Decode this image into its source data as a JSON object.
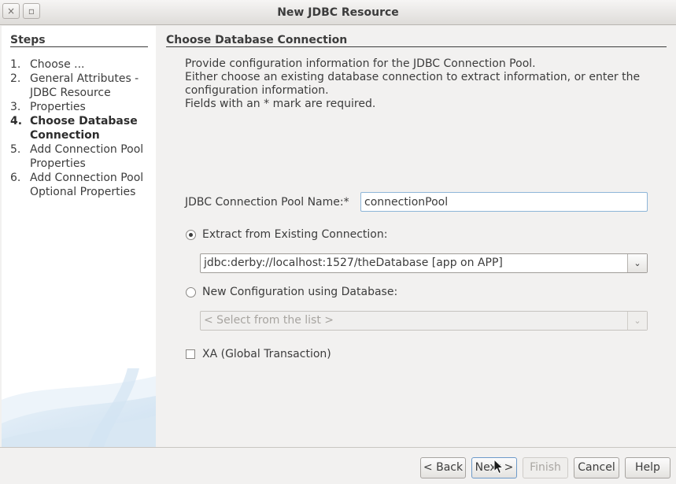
{
  "window": {
    "title": "New JDBC Resource",
    "close_glyph": "×",
    "maximize_glyph": "▫"
  },
  "sidebar": {
    "title": "Steps",
    "steps": [
      {
        "num": "1.",
        "label": "Choose ...",
        "current": false
      },
      {
        "num": "2.",
        "label": "General Attributes - JDBC Resource",
        "current": false
      },
      {
        "num": "3.",
        "label": "Properties",
        "current": false
      },
      {
        "num": "4.",
        "label": "Choose Database Connection",
        "current": true
      },
      {
        "num": "5.",
        "label": "Add Connection Pool Properties",
        "current": false
      },
      {
        "num": "6.",
        "label": "Add Connection Pool Optional Properties",
        "current": false
      }
    ]
  },
  "main": {
    "title": "Choose Database Connection",
    "description": [
      "Provide configuration information for the JDBC Connection Pool.",
      "Either choose an existing database connection to extract information, or enter the configuration information.",
      "Fields with an * mark are required."
    ],
    "pool_name_label": "JDBC Connection Pool Name:*",
    "pool_name_value": "connectionPool",
    "extract_label": "Extract from Existing Connection:",
    "extract_checked": true,
    "existing_connection_value": "jdbc:derby://localhost:1527/theDatabase [app on APP]",
    "new_config_label": "New Configuration using Database:",
    "new_config_checked": false,
    "database_placeholder": "< Select from the list >",
    "xa_label": "XA (Global Transaction)",
    "xa_checked": false,
    "dropdown_glyph": "⌄"
  },
  "footer": {
    "back_label": "< Back",
    "next_label": "Next >",
    "finish_label": "Finish",
    "cancel_label": "Cancel",
    "help_label": "Help"
  },
  "colors": {
    "focus_border": "#8eb6d8",
    "panel_bg": "#f2f1f0",
    "sidebar_bg": "#ffffff"
  }
}
